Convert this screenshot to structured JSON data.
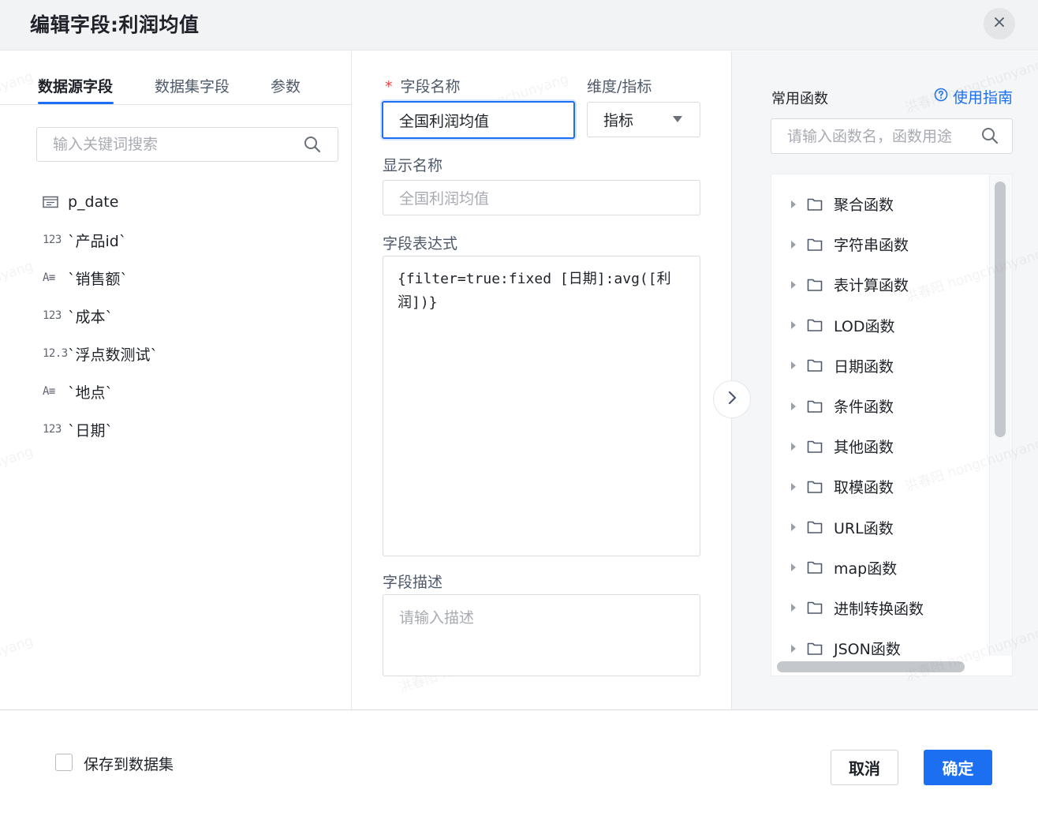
{
  "dialog": {
    "title": "编辑字段:利润均值"
  },
  "left": {
    "tabs": [
      {
        "label": "数据源字段",
        "active": true
      },
      {
        "label": "数据集字段",
        "active": false
      },
      {
        "label": "参数",
        "active": false
      }
    ],
    "search": {
      "placeholder": "输入关键词搜索",
      "icon": "search-icon"
    },
    "fields": [
      {
        "type_icon": "date-icon",
        "type_text": "",
        "name": "p_date"
      },
      {
        "type_icon": "number-icon",
        "type_text": "123",
        "name": "`产品id`"
      },
      {
        "type_icon": "text-icon",
        "type_text": "A≡",
        "name": "`销售额`"
      },
      {
        "type_icon": "number-icon",
        "type_text": "123",
        "name": "`成本`"
      },
      {
        "type_icon": "decimal-icon",
        "type_text": "12.3",
        "name": "`浮点数测试`"
      },
      {
        "type_icon": "text-icon",
        "type_text": "A≡",
        "name": "`地点`"
      },
      {
        "type_icon": "number-icon",
        "type_text": "123",
        "name": "`日期`"
      }
    ]
  },
  "form": {
    "field_name_label": "字段名称",
    "required_mark": "*",
    "field_name_value": "全国利润均值",
    "dimension_label": "维度/指标",
    "dimension_value": "指标",
    "display_name_label": "显示名称",
    "display_name_placeholder": "全国利润均值",
    "expression_label": "字段表达式",
    "expression_value": "{filter=true:fixed [日期]:avg([利润])}",
    "description_label": "字段描述",
    "description_placeholder": "请输入描述"
  },
  "functions": {
    "title": "常用函数",
    "guide_link": "使用指南",
    "search_placeholder": "请输入函数名，函数用途",
    "categories": [
      "聚合函数",
      "字符串函数",
      "表计算函数",
      "LOD函数",
      "日期函数",
      "条件函数",
      "其他函数",
      "取模函数",
      "URL函数",
      "map函数",
      "进制转换函数",
      "JSON函数"
    ]
  },
  "footer": {
    "save_to_dataset_label": "保存到数据集",
    "save_to_dataset_checked": false,
    "cancel_label": "取消",
    "confirm_label": "确定"
  },
  "colors": {
    "primary": "#1d6ff2",
    "required": "#f53f3f",
    "header_bg": "#f2f3f5",
    "panel_bg": "#f5f6f7"
  }
}
